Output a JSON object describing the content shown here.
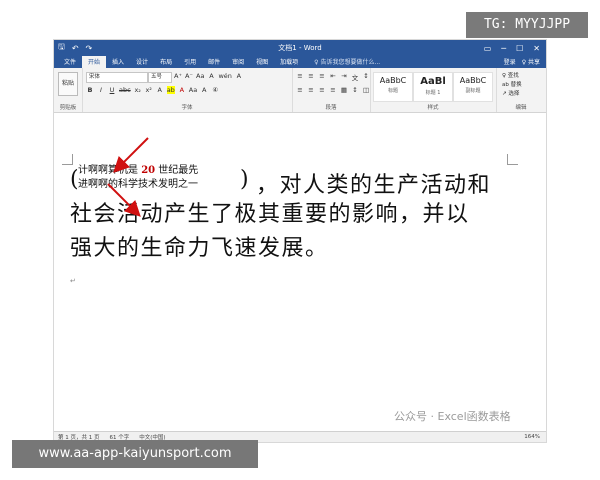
{
  "badge": "TG: MYYJJPP",
  "footer_url": "www.aa-app-kaiyunsport.com",
  "window": {
    "title": "文档1 - Word",
    "controls": [
      "▭",
      "─",
      "☐",
      "✕"
    ]
  },
  "quick_access": {
    "save": "🖫",
    "undo": "↶",
    "redo": "↷"
  },
  "tabs": [
    "文件",
    "开始",
    "插入",
    "设计",
    "布局",
    "引用",
    "邮件",
    "审阅",
    "视图",
    "加载项"
  ],
  "tell_me": "♀ 告诉我您想要做什么...",
  "account": {
    "signin": "登录",
    "share": "♀ 共享"
  },
  "ribbon": {
    "clipboard": {
      "paste": "粘贴",
      "label": "剪贴板"
    },
    "font": {
      "font_name": "宋体",
      "font_size": "五号",
      "row1": [
        "A⁺",
        "A⁻",
        "Aa",
        "A",
        "wén",
        "A"
      ],
      "row2": [
        "B",
        "I",
        "U",
        "abc",
        "x₂",
        "x²",
        "A",
        "ab",
        "A",
        "Aa",
        "A",
        "④"
      ],
      "label": "字体"
    },
    "paragraph": {
      "row1": [
        "≡",
        "≡",
        "≡",
        "⇤",
        "⇥",
        "文",
        "↕",
        "¶"
      ],
      "row2": [
        "≡",
        "≡",
        "≡",
        "≡",
        "▦",
        "↕",
        "◫",
        "▦"
      ],
      "label": "段落"
    },
    "styles": {
      "items": [
        {
          "sample": "AaBbC",
          "name": "标题"
        },
        {
          "sample": "AaBl",
          "name": "标题 1"
        },
        {
          "sample": "AaBbC",
          "name": "副标题"
        }
      ],
      "label": "样式"
    },
    "editing": {
      "items": [
        "♀ 查找",
        "ab 替换",
        "↗ 选择"
      ],
      "label": "编辑"
    }
  },
  "document": {
    "ruby_line1_a": "计啊啊算机是 ",
    "ruby_number": "20",
    "ruby_line1_b": " 世纪最先",
    "ruby_line2": "进啊啊的科学技术发明之一",
    "paren_open": "(",
    "paren_close": ")",
    "line1_rest": "，对人类的生产活动和",
    "line2": "社会活动产生了极其重要的影响，并以",
    "line3": "强大的生命力飞速发展。"
  },
  "status": {
    "page": "第 1 页，共 1 页",
    "words": "61 个字",
    "lang": "中文(中国)",
    "zoom": "164%"
  },
  "watermark": "公众号 · Excel函数表格"
}
